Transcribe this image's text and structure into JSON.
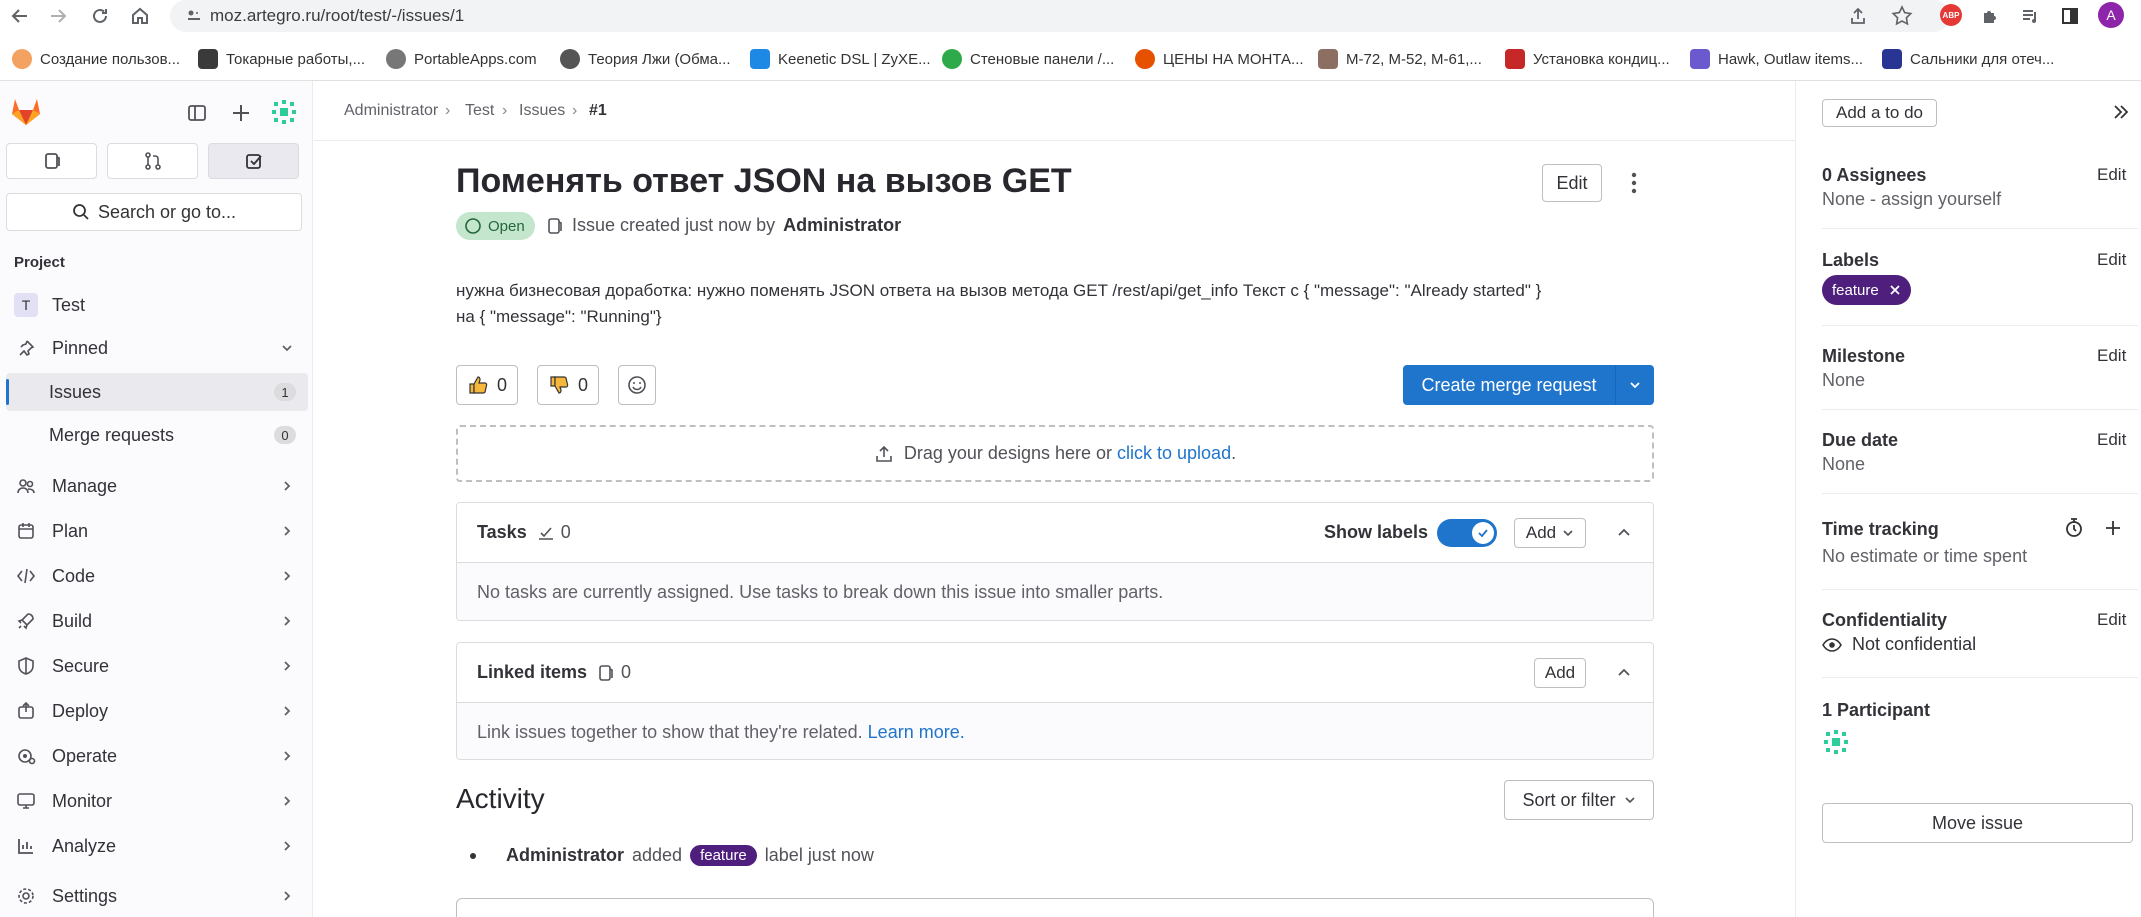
{
  "browser": {
    "url": "moz.artegro.ru/root/test/-/issues/1",
    "profile_initial": "A",
    "bookmarks": [
      {
        "label": "Создание пользов...",
        "color": "#f4a261"
      },
      {
        "label": "Токарные работы,...",
        "color": "#3a3a3a"
      },
      {
        "label": "PortableApps.com",
        "color": "#777777"
      },
      {
        "label": "Теория Лжи (Обма...",
        "color": "#555555"
      },
      {
        "label": "Keenetic DSL | ZyXE...",
        "color": "#1e88e5"
      },
      {
        "label": "Стеновые панели /...",
        "color": "#2eaa4a"
      },
      {
        "label": "ЦЕНЫ НА МОНТА...",
        "color": "#e65100"
      },
      {
        "label": "М-72, М-52, М-61,...",
        "color": "#8d6e63"
      },
      {
        "label": "Установка кондиц...",
        "color": "#c62828"
      },
      {
        "label": "Hawk, Outlaw items...",
        "color": "#6a5acd"
      },
      {
        "label": "Сальники для отеч...",
        "color": "#283593"
      }
    ]
  },
  "sidebar": {
    "search_placeholder": "Search or go to...",
    "section_label": "Project",
    "project": {
      "initial": "T",
      "name": "Test"
    },
    "pinned_label": "Pinned",
    "pinned_items": [
      {
        "label": "Issues",
        "count": "1"
      },
      {
        "label": "Merge requests",
        "count": "0"
      }
    ],
    "groups": [
      "Manage",
      "Plan",
      "Code",
      "Build",
      "Secure",
      "Deploy",
      "Operate",
      "Monitor",
      "Analyze",
      "Settings"
    ]
  },
  "breadcrumb": [
    "Administrator",
    "Test",
    "Issues",
    "#1"
  ],
  "issue": {
    "title": "Поменять ответ JSON на вызов GET",
    "edit_label": "Edit",
    "status": "Open",
    "meta_prefix": "Issue created just now by",
    "author": "Administrator",
    "description_line1": "нужна бизнесовая доработка: нужно поменять JSON ответа на вызов метода GET /rest/api/get_info Текст с { \"message\": \"Already started\" }",
    "description_line2": "на { \"message\": \"Running\"}",
    "thumbs_up": "0",
    "thumbs_down": "0",
    "create_mr_label": "Create merge request",
    "dropzone_text": "Drag your designs here or",
    "dropzone_link": "click to upload",
    "dropzone_end": "."
  },
  "tasks": {
    "title": "Tasks",
    "count": "0",
    "show_labels": "Show labels",
    "add_label": "Add",
    "empty_text": "No tasks are currently assigned. Use tasks to break down this issue into smaller parts."
  },
  "linked": {
    "title": "Linked items",
    "count": "0",
    "add_label": "Add",
    "empty_text": "Link issues together to show that they're related.",
    "learn_more": "Learn more."
  },
  "activity": {
    "title": "Activity",
    "sort_label": "Sort or filter",
    "actor": "Administrator",
    "verb": "added",
    "label": "feature",
    "suffix": "label just now"
  },
  "right_panel": {
    "todo_label": "Add a to do",
    "assignees_title": "0 Assignees",
    "assignees_value": "None - assign yourself",
    "labels_title": "Labels",
    "label_pill": "feature",
    "milestone_title": "Milestone",
    "milestone_value": "None",
    "due_title": "Due date",
    "due_value": "None",
    "time_title": "Time tracking",
    "time_value": "No estimate or time spent",
    "conf_title": "Confidentiality",
    "conf_value": "Not confidential",
    "participants_title": "1 Participant",
    "move_label": "Move issue",
    "edit_label": "Edit"
  },
  "colors": {
    "primary": "#1f75cb",
    "label_purple": "#4f1f7d",
    "open_green": "#c3e6cd",
    "gitlab_orange": "#fc6d26"
  }
}
